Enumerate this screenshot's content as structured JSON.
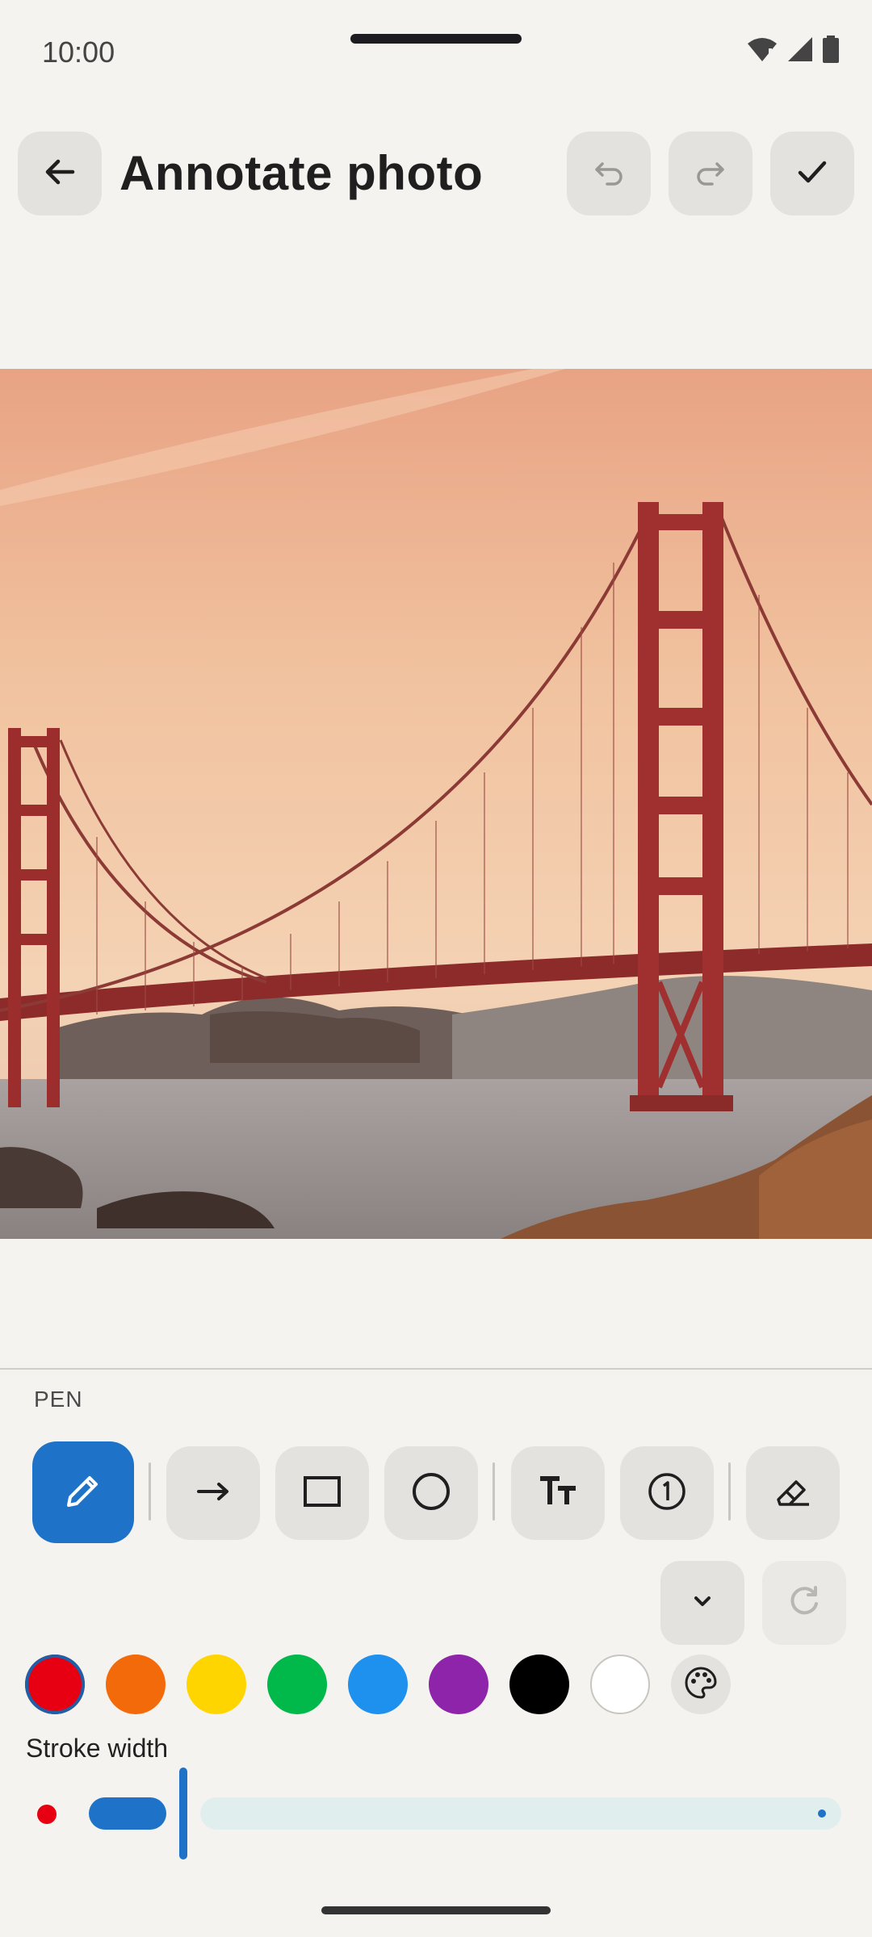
{
  "status_bar": {
    "time": "10:00"
  },
  "app_bar": {
    "title": "Annotate photo",
    "back_icon": "arrow-back-icon",
    "undo_icon": "undo-icon",
    "redo_icon": "redo-icon",
    "done_icon": "check-icon"
  },
  "editor": {
    "mode_label": "PEN",
    "tools": [
      {
        "name": "pen",
        "icon": "pencil-icon",
        "active": true
      },
      {
        "name": "arrow",
        "icon": "arrow-right-icon",
        "active": false
      },
      {
        "name": "rectangle",
        "icon": "rectangle-icon",
        "active": false
      },
      {
        "name": "circle",
        "icon": "circle-icon",
        "active": false
      },
      {
        "name": "text",
        "icon": "text-icon",
        "active": false
      },
      {
        "name": "step-number",
        "icon": "numbered-circle-icon",
        "active": false
      },
      {
        "name": "eraser",
        "icon": "eraser-icon",
        "active": false
      }
    ],
    "colors": [
      {
        "name": "red",
        "hex": "#e60012",
        "selected": true
      },
      {
        "name": "orange",
        "hex": "#f26a0a",
        "selected": false
      },
      {
        "name": "yellow",
        "hex": "#ffd500",
        "selected": false
      },
      {
        "name": "green",
        "hex": "#00b94a",
        "selected": false
      },
      {
        "name": "blue",
        "hex": "#1e90ee",
        "selected": false
      },
      {
        "name": "purple",
        "hex": "#8e24aa",
        "selected": false
      },
      {
        "name": "black",
        "hex": "#000000",
        "selected": false
      },
      {
        "name": "white",
        "hex": "#ffffff",
        "selected": false
      }
    ],
    "stroke_width_label": "Stroke width",
    "stroke_width_fraction": 0.11,
    "accent_color": "#1e73c8"
  }
}
